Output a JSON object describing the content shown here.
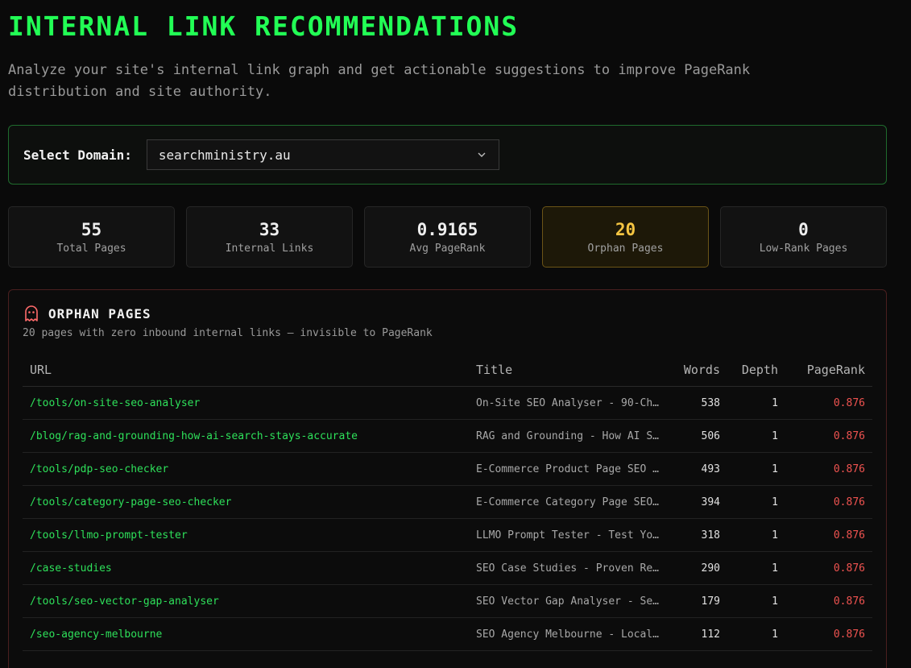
{
  "header": {
    "title": "INTERNAL LINK RECOMMENDATIONS",
    "subtitle_line1": "Analyze your site's internal link graph and get actionable suggestions to improve PageRank",
    "subtitle_line2": "distribution and site authority."
  },
  "domain_selector": {
    "label": "Select Domain:",
    "value": "searchministry.au"
  },
  "stats": [
    {
      "value": "55",
      "label": "Total Pages"
    },
    {
      "value": "33",
      "label": "Internal Links"
    },
    {
      "value": "0.9165",
      "label": "Avg PageRank"
    },
    {
      "value": "20",
      "label": "Orphan Pages"
    },
    {
      "value": "0",
      "label": "Low-Rank Pages"
    }
  ],
  "orphans": {
    "title": "ORPHAN PAGES",
    "description": "20 pages with zero inbound internal links — invisible to PageRank",
    "columns": [
      "URL",
      "Title",
      "Words",
      "Depth",
      "PageRank"
    ],
    "rows": [
      {
        "url": "/tools/on-site-seo-analyser",
        "title": "On-Site SEO Analyser - 90-Ch…",
        "words": "538",
        "depth": "1",
        "pagerank": "0.876"
      },
      {
        "url": "/blog/rag-and-grounding-how-ai-search-stays-accurate",
        "title": "RAG and Grounding - How AI S…",
        "words": "506",
        "depth": "1",
        "pagerank": "0.876"
      },
      {
        "url": "/tools/pdp-seo-checker",
        "title": "E-Commerce Product Page SEO …",
        "words": "493",
        "depth": "1",
        "pagerank": "0.876"
      },
      {
        "url": "/tools/category-page-seo-checker",
        "title": "E-Commerce Category Page SEO…",
        "words": "394",
        "depth": "1",
        "pagerank": "0.876"
      },
      {
        "url": "/tools/llmo-prompt-tester",
        "title": "LLMO Prompt Tester - Test Yo…",
        "words": "318",
        "depth": "1",
        "pagerank": "0.876"
      },
      {
        "url": "/case-studies",
        "title": "SEO Case Studies - Proven Re…",
        "words": "290",
        "depth": "1",
        "pagerank": "0.876"
      },
      {
        "url": "/tools/seo-vector-gap-analyser",
        "title": "SEO Vector Gap Analyser - Se…",
        "words": "179",
        "depth": "1",
        "pagerank": "0.876"
      },
      {
        "url": "/seo-agency-melbourne",
        "title": "SEO Agency Melbourne - Local…",
        "words": "112",
        "depth": "1",
        "pagerank": "0.876"
      }
    ]
  },
  "colors": {
    "accent": "#22ff55",
    "warning": "#f5c542",
    "danger": "#ef5350"
  }
}
